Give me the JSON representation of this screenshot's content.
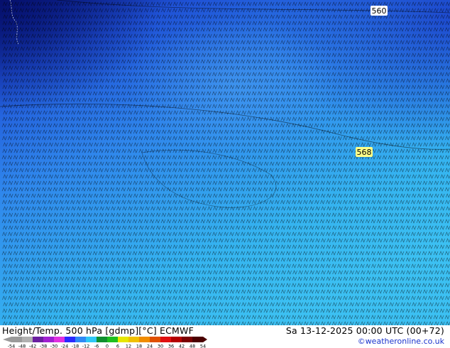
{
  "header": {
    "title": "Height/Temp. 500 hPa [gdmp][°C] ECMWF",
    "datetime": "Sa 13-12-2025 00:00 UTC (00+72)",
    "credit": "©weatheronline.co.uk"
  },
  "map": {
    "contour_labels": [
      "560",
      "568"
    ],
    "contour_label_color": "#ffff88",
    "wind_barb_color": "#000000",
    "field_colors": {
      "cold_dark": "#0a1e8c",
      "cold": "#1f52d6",
      "mid": "#2f86ec",
      "warm": "#35b4f0"
    }
  },
  "color_scale": {
    "ticks": [
      "-54",
      "-48",
      "-42",
      "-38",
      "-30",
      "-24",
      "-18",
      "-12",
      "-6",
      "0",
      "6",
      "12",
      "18",
      "24",
      "30",
      "36",
      "42",
      "48",
      "54"
    ],
    "colors": [
      "#9a9a9a",
      "#b0b0b0",
      "#6a1fa0",
      "#a020d0",
      "#e030e0",
      "#2a2aff",
      "#2f8af5",
      "#2fc8f5",
      "#0f8f2f",
      "#1fbf1f",
      "#e6e600",
      "#f0c000",
      "#f08c00",
      "#e05000",
      "#e01010",
      "#b40000",
      "#7a0000",
      "#4a0000"
    ]
  }
}
